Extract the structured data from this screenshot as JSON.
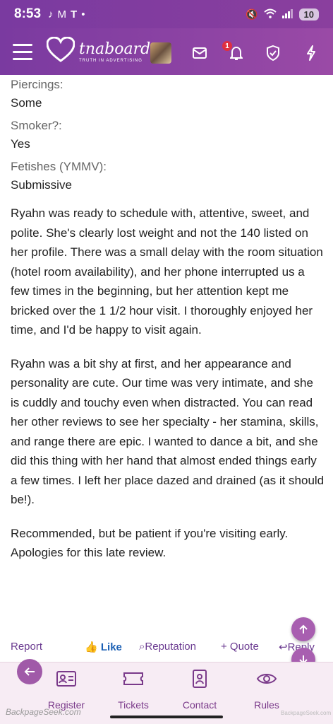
{
  "status": {
    "time": "8:53",
    "left_icons": [
      "tiktok-icon",
      "gmail-icon",
      "t-icon",
      "dot"
    ],
    "right_icons": [
      "mute-icon",
      "wifi-icon",
      "signal-icon"
    ],
    "battery": "10"
  },
  "nav": {
    "brand": "tnaboard",
    "tagline": "TRUTH IN ADVERTISING",
    "alerts_count": "1"
  },
  "fields": [
    {
      "label": "Piercings:",
      "value": "Some"
    },
    {
      "label": "Smoker?:",
      "value": "Yes"
    },
    {
      "label": "Fetishes (YMMV):",
      "value": "Submissive"
    }
  ],
  "paragraphs": [
    "Ryahn was ready to schedule with, attentive, sweet, and polite. She's clearly lost weight and not the 140 listed on her profile. There was a small delay with the room situation (hotel room availability), and her phone interrupted us a few times in the beginning, but her attention kept me bricked over the 1 1/2 hour visit. I thoroughly enjoyed her time, and I'd be happy to visit again.",
    "Ryahn was a bit shy at first, and her appearance and personality are cute. Our time was very intimate, and she is cuddly and touchy even when distracted. You can read her other reviews to see her specialty - her stamina, skills, and range there are epic. I wanted to dance a bit, and she did this thing with her hand that almost ended things early a few times. I left her place dazed and drained (as it should be!).",
    "Recommended, but be patient if you're visiting early. Apologies for this late review."
  ],
  "actions": {
    "report": "Report",
    "like": "Like",
    "reputation": "Reputation",
    "quote": "+ Quote",
    "reply": "Reply"
  },
  "bottom_nav": [
    {
      "label": "Register",
      "icon": "id-card-icon"
    },
    {
      "label": "Tickets",
      "icon": "ticket-icon"
    },
    {
      "label": "Contact",
      "icon": "contact-book-icon"
    },
    {
      "label": "Rules",
      "icon": "eye-icon"
    }
  ],
  "watermark_left": "BackpageSeek.com",
  "watermark_right": "BackpageSeek.com",
  "colors": {
    "header": "#7a3aa0",
    "accent": "#a85fb0",
    "like": "#1a5fb4"
  }
}
